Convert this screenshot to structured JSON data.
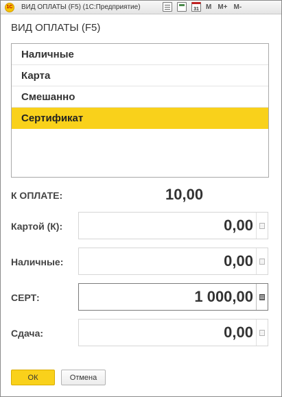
{
  "window": {
    "title": "ВИД ОПЛАТЫ (F5)  (1С:Предприятие)",
    "logo_text": "1С",
    "toolbar": {
      "m": "M",
      "m_plus": "M+",
      "m_minus": "M-",
      "calendar_day": "31"
    }
  },
  "form": {
    "title": "ВИД ОПЛАТЫ (F5)"
  },
  "payment_types": [
    {
      "label": "Наличные",
      "selected": false
    },
    {
      "label": "Карта",
      "selected": false
    },
    {
      "label": "Смешанно",
      "selected": false
    },
    {
      "label": "Сертификат",
      "selected": true
    }
  ],
  "to_pay": {
    "label": "К ОПЛАТЕ:",
    "value": "10,00"
  },
  "fields": {
    "card": {
      "label": "Картой (К):",
      "value": "0,00"
    },
    "cash": {
      "label": "Наличные:",
      "value": "0,00"
    },
    "cert": {
      "label": "СЕРТ:",
      "value": "1 000,00"
    },
    "change": {
      "label": "Сдача:",
      "value": "0,00"
    }
  },
  "buttons": {
    "ok": "ОК",
    "cancel": "Отмена"
  },
  "colors": {
    "accent": "#f9d11b",
    "text": "#333333"
  }
}
